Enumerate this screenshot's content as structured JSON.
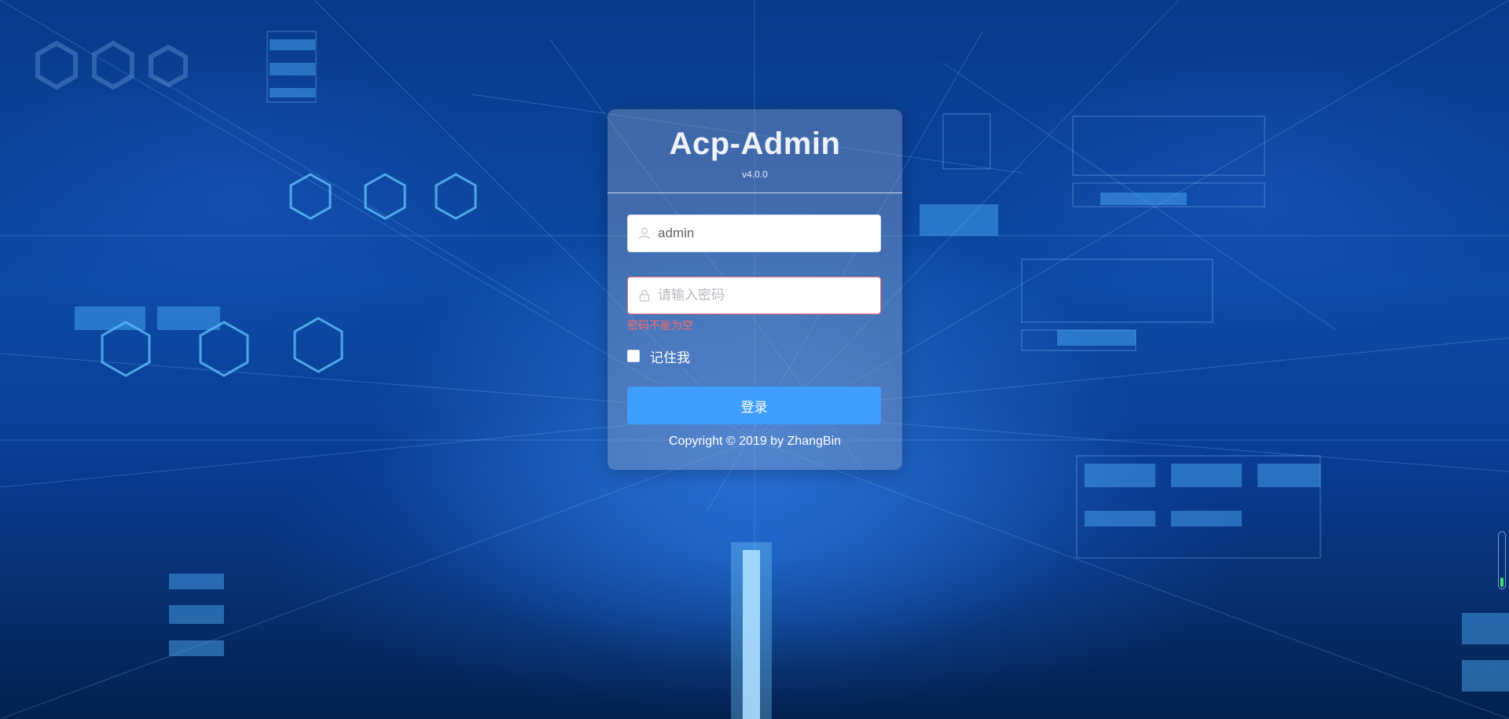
{
  "login": {
    "title": "Acp-Admin",
    "version": "v4.0.0",
    "username": {
      "value": "admin",
      "icon": "user-icon"
    },
    "password": {
      "value": "",
      "placeholder": "请输入密码",
      "icon": "lock-icon",
      "error": "密码不能为空"
    },
    "remember": {
      "label": "记住我",
      "checked": false
    },
    "submit_label": "登录",
    "copyright": "Copyright © 2019 by ZhangBin"
  },
  "colors": {
    "primary": "#409eff",
    "error": "#f56c6c",
    "background": "#0b4aa6"
  }
}
